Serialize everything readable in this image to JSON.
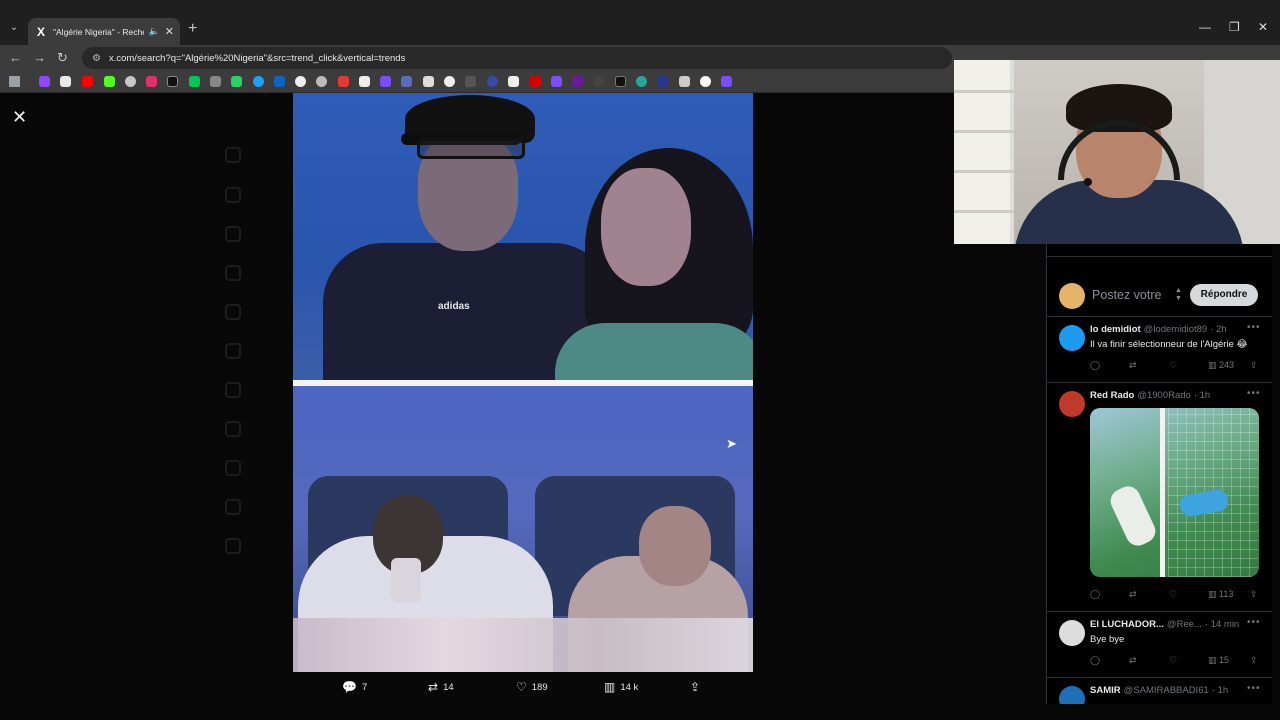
{
  "browser": {
    "tab_title": "\"Algérie Nigeria\" - Recherch",
    "tab_favicon": "X",
    "url": "x.com/search?q=\"Algérie%20Nigeria\"&src=trend_click&vertical=trends",
    "win_minimize": "—",
    "win_maximize": "❐",
    "win_close": "✕",
    "new_tab": "+",
    "back": "←",
    "forward": "→",
    "reload": "↻"
  },
  "media": {
    "close": "✕",
    "logo_text": "adidas",
    "actions": {
      "replies": "7",
      "reposts": "14",
      "likes": "189",
      "views": "14 k"
    }
  },
  "reply_panel": {
    "placeholder": "Postez votre",
    "reply_button": "Répondre",
    "tweets": [
      {
        "name": "lo demidiot",
        "handle": "@lodemidiot89",
        "time": "· 2h",
        "text": "Il va finir sélectionneur de l'Algérie 😂",
        "views": "243",
        "avatar_color": "#1d9bf0"
      },
      {
        "name": "Red Rado",
        "handle": "@1900Rado",
        "time": "· 1h",
        "text": "",
        "views": "113",
        "avatar_color": "#c0392b"
      },
      {
        "name": "El LUCHADOR...",
        "handle": "@Ree...",
        "time": "· 14 min",
        "text": "Bye bye",
        "views": "15",
        "avatar_color": "#dddddd"
      },
      {
        "name": "SAMIR",
        "handle": "@SAMIRABBADI61",
        "time": "· 1h",
        "text": "",
        "views": "",
        "avatar_color": "#1d6fb8"
      }
    ]
  },
  "icons": {
    "reply": "reply-icon",
    "repost": "repost-icon",
    "like": "heart-icon",
    "views": "views-icon",
    "share": "share-icon"
  },
  "colors": {
    "x_background": "#000000",
    "reply_button": "#d6d9db",
    "secondary_text": "#71767b"
  }
}
